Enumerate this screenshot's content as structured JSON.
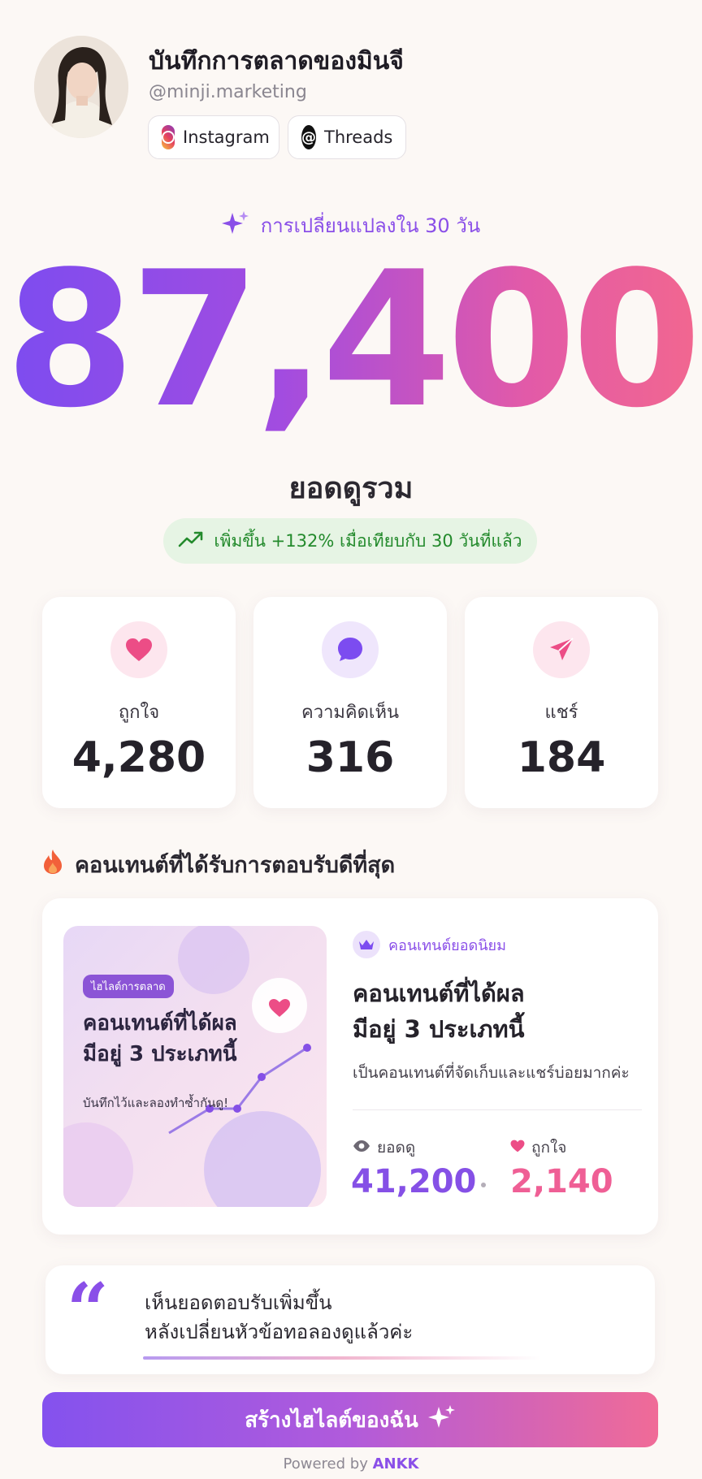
{
  "profile": {
    "name": "บันทึกการตลาดของมินจี",
    "handle": "@minji.marketing",
    "platforms": [
      "Instagram",
      "Threads"
    ]
  },
  "summary": {
    "period": "การเปลี่ยนแปลงใน 30 วัน",
    "total_views": "87,400",
    "total_label": "ยอดดูรวม",
    "growth": "เพิ่มขึ้น +132% เมื่อเทียบกับ 30 วันที่แล้ว"
  },
  "stats": [
    {
      "label": "ถูกใจ",
      "value": "4,280",
      "icon": "heart-icon"
    },
    {
      "label": "ความคิดเห็น",
      "value": "316",
      "icon": "comment-icon"
    },
    {
      "label": "แชร์",
      "value": "184",
      "icon": "send-icon"
    }
  ],
  "top_content": {
    "section_title": "คอนเทนต์ที่ได้รับการตอบรับดีที่สุด",
    "thumb_tag": "ไฮไลต์การตลาด",
    "thumb_title_1": "คอนเทนต์ที่ได้ผล",
    "thumb_title_2": "มีอยู่ 3 ประเภทนี้",
    "thumb_sub": "บันทึกไว้และลองทำซ้ำกันดู!",
    "badge": "คอนเทนต์ยอดนิยม",
    "title_1": "คอนเทนต์ที่ได้ผล",
    "title_2": "มีอยู่ 3 ประเภทนี้",
    "desc": "เป็นคอนเทนต์ที่จัดเก็บและแชร์บ่อยมากค่ะ",
    "views_label": "ยอดดู",
    "views_value": "41,200",
    "likes_label": "ถูกใจ",
    "likes_value": "2,140"
  },
  "quote": {
    "line1": "เห็นยอดตอบรับเพิ่มขึ้น",
    "line2": "หลังเปลี่ยนหัวข้อทอลองดูแล้วค่ะ"
  },
  "cta": {
    "label": "สร้างไฮไลต์ของฉัน"
  },
  "footer": {
    "powered": "Powered by",
    "brand": "ANKK"
  },
  "colors": {
    "accent": "#8a4fe8",
    "pink": "#ef5f95",
    "growth": "#238a2c"
  }
}
